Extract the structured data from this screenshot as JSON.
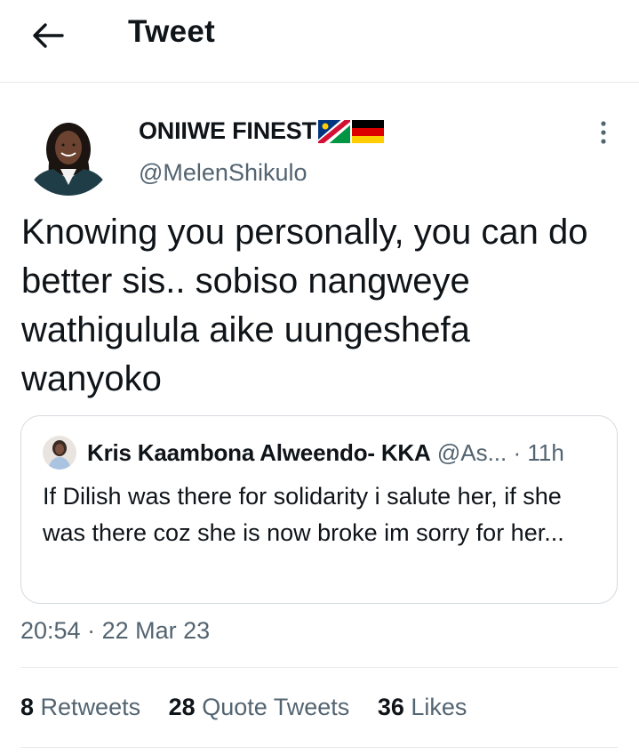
{
  "header": {
    "title": "Tweet",
    "back_icon": "arrow-left-icon"
  },
  "author": {
    "display_name": "ONIIWE FINEST",
    "flags": [
      "namibia-flag",
      "germany-flag"
    ],
    "handle": "@MelenShikulo",
    "more_icon": "more-vertical-icon"
  },
  "tweet": {
    "text": "Knowing you personally, you can do better sis.. sobiso nangweye wathigulula aike uungeshefa wanyoko",
    "time": "20:54",
    "separator": "·",
    "date": "22 Mar 23"
  },
  "quoted": {
    "name": "Kris Kaambona Alweendo- KKA",
    "handle": "@As...",
    "separator": "·",
    "age": "11h",
    "text": "If Dilish was there for solidarity i salute her, if she was there coz she is now broke im sorry for her..."
  },
  "stats": {
    "retweets_count": "8",
    "retweets_label": "Retweets",
    "quotes_count": "28",
    "quotes_label": "Quote Tweets",
    "likes_count": "36",
    "likes_label": "Likes"
  }
}
